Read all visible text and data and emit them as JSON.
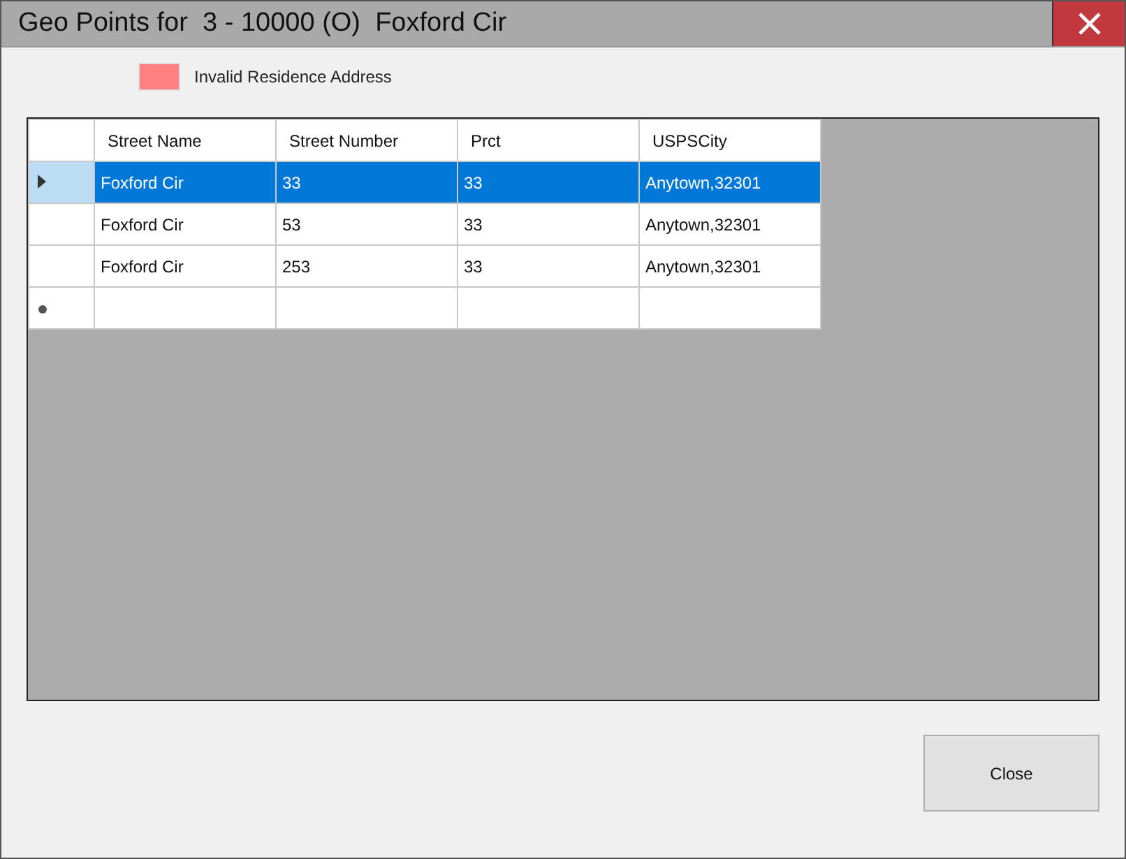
{
  "window": {
    "title": "Geo Points for  3 - 10000 (O)  Foxford Cir"
  },
  "legend": [
    {
      "label": "Invalid Residence Address",
      "color": "#ff8080"
    }
  ],
  "table": {
    "columns": [
      "Street Name",
      "Street Number",
      "Prct",
      "USPSCity"
    ],
    "rows": [
      {
        "cells": [
          "Foxford Cir",
          "33",
          "33",
          "Anytown,32301"
        ],
        "selected": true
      },
      {
        "cells": [
          "Foxford Cir",
          "53",
          "33",
          "Anytown,32301"
        ],
        "selected": false
      },
      {
        "cells": [
          "Foxford Cir",
          "253",
          "33",
          "Anytown,32301"
        ],
        "selected": false
      }
    ],
    "new_row": true
  },
  "buttons": [
    "Close"
  ]
}
